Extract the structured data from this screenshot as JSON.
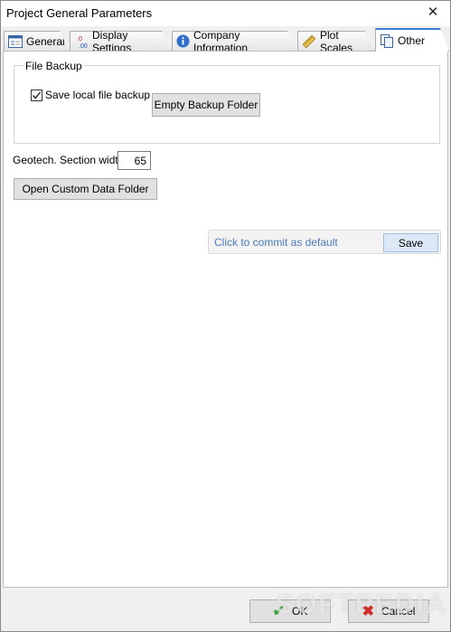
{
  "window": {
    "title": "Project General Parameters",
    "close_icon": "close-icon"
  },
  "tabs": [
    {
      "label": "General",
      "icon": "form-icon",
      "active": false
    },
    {
      "label": "Display Settings",
      "icon": "decimal-icon",
      "active": false
    },
    {
      "label": "Company Information",
      "icon": "info-icon",
      "active": false
    },
    {
      "label": "Plot Scales",
      "icon": "ruler-icon",
      "active": false
    },
    {
      "label": "Other",
      "icon": "documents-icon",
      "active": true
    }
  ],
  "file_backup": {
    "group_title": "File Backup",
    "save_local_label": "Save local file backup",
    "save_local_checked": true,
    "empty_button": "Empty Backup Folder"
  },
  "geotech": {
    "label": "Geotech. Section width",
    "value": "65"
  },
  "open_folder_button": "Open Custom Data Folder",
  "commit": {
    "text": "Click to commit as default",
    "save_label": "Save"
  },
  "footer": {
    "ok_label": "OK",
    "cancel_label": "Cancel"
  },
  "watermark": "SOFTPEDIA",
  "colors": {
    "accent": "#3c7fd4",
    "commit_text": "#4a7ab7",
    "ok_check": "#3aa33a",
    "cancel_x": "#d22b2b"
  }
}
